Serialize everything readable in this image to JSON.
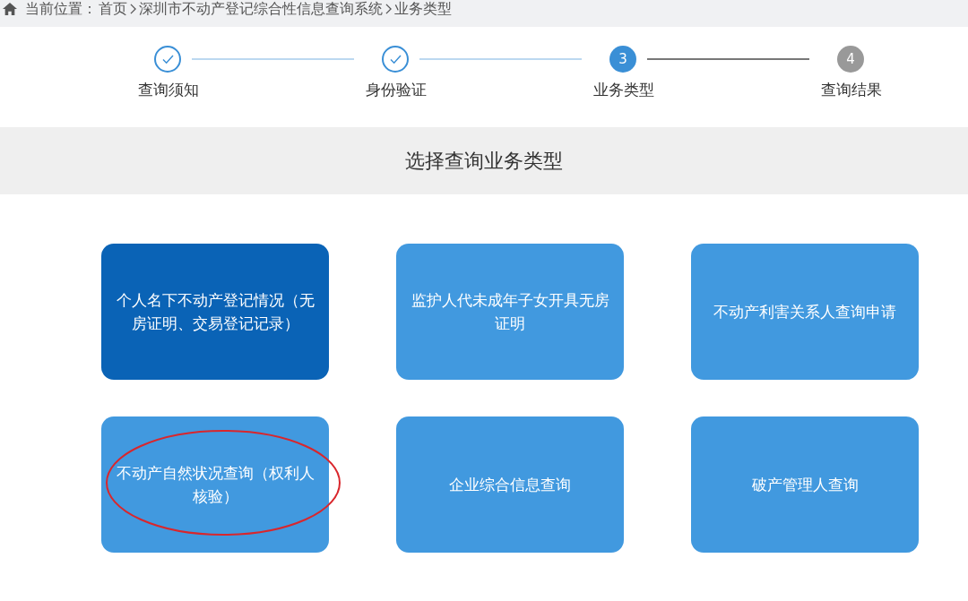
{
  "breadcrumb": {
    "label": "当前位置：",
    "items": [
      "首页",
      "深圳市不动产登记综合性信息查询系统",
      "业务类型"
    ]
  },
  "steps": [
    {
      "label": "查询须知",
      "done": true,
      "current": false
    },
    {
      "label": "身份验证",
      "done": true,
      "current": false
    },
    {
      "label": "业务类型",
      "done": false,
      "current": true,
      "number": "3"
    },
    {
      "label": "查询结果",
      "done": false,
      "current": false,
      "number": "4"
    }
  ],
  "section_title": "选择查询业务类型",
  "options": [
    {
      "label": "个人名下不动产登记情况（无房证明、交易登记记录）",
      "selected": true,
      "annotated": false
    },
    {
      "label": "监护人代未成年子女开具无房证明",
      "selected": false,
      "annotated": false
    },
    {
      "label": "不动产利害关系人查询申请",
      "selected": false,
      "annotated": false
    },
    {
      "label": "不动产自然状况查询（权利人核验）",
      "selected": false,
      "annotated": true
    },
    {
      "label": "企业综合信息查询",
      "selected": false,
      "annotated": false
    },
    {
      "label": "破产管理人查询",
      "selected": false,
      "annotated": false
    }
  ]
}
